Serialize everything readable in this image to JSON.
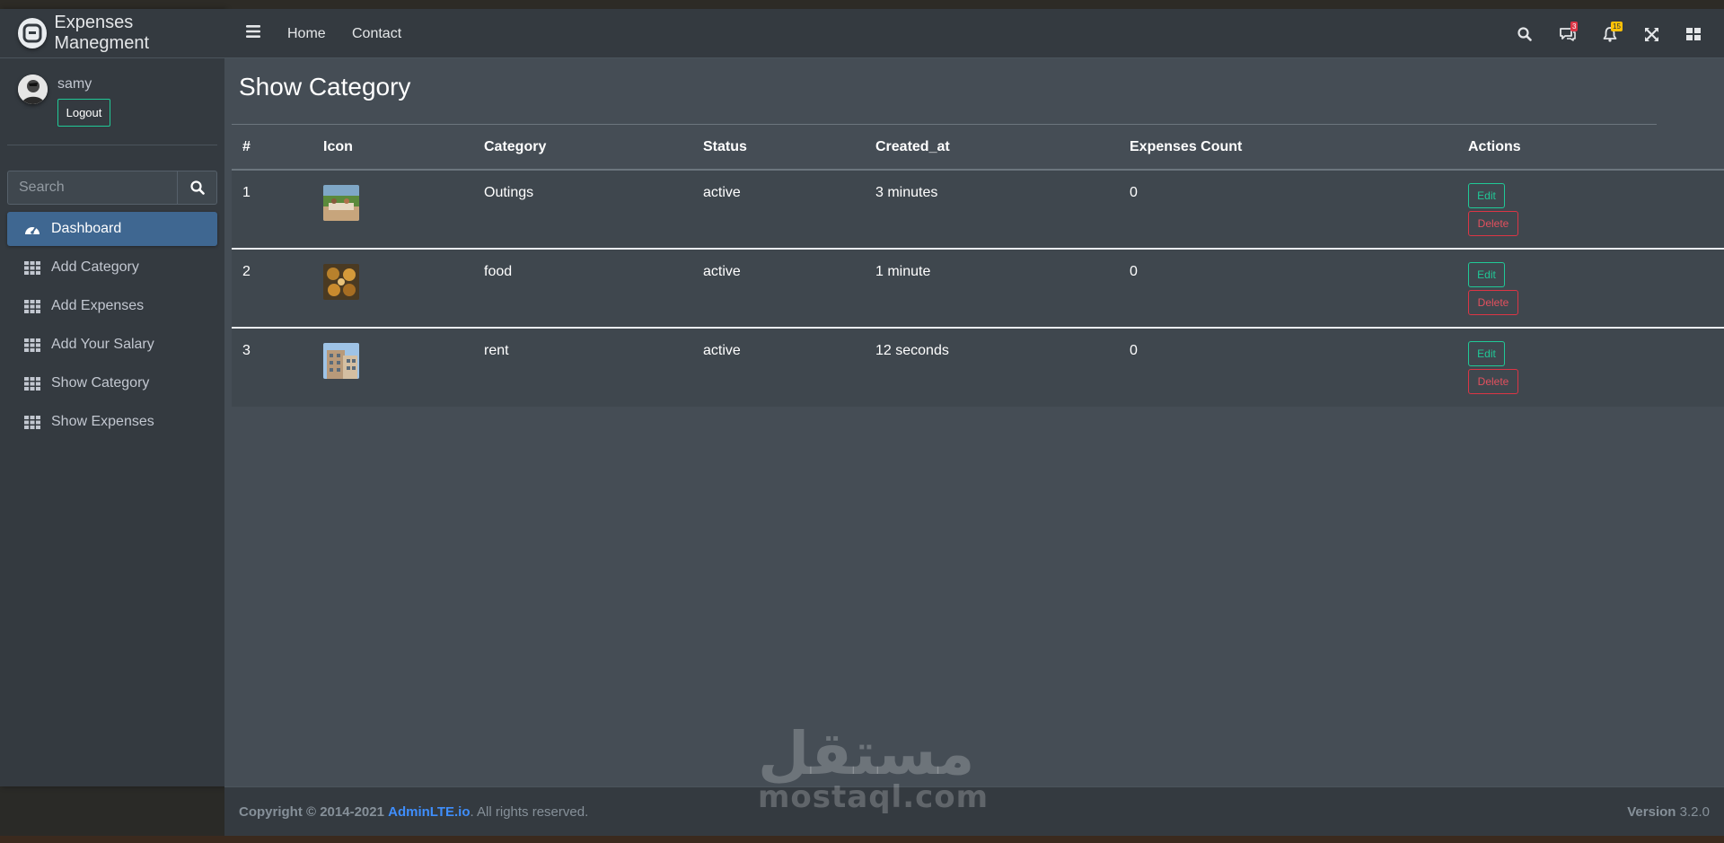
{
  "brand": {
    "title": "Expenses Manegment",
    "logo_icon": "adminlte-logo-icon"
  },
  "user": {
    "name": "samy",
    "logout_label": "Logout"
  },
  "sidebar_search": {
    "placeholder": "Search",
    "icon": "search-icon"
  },
  "sidebar": {
    "items": [
      {
        "label": "Dashboard",
        "icon": "tachometer-icon",
        "active": true
      },
      {
        "label": "Add Category",
        "icon": "table-icon",
        "active": false
      },
      {
        "label": "Add Expenses",
        "icon": "table-icon",
        "active": false
      },
      {
        "label": "Add Your Salary",
        "icon": "table-icon",
        "active": false
      },
      {
        "label": "Show Category",
        "icon": "table-icon",
        "active": false
      },
      {
        "label": "Show Expenses",
        "icon": "table-icon",
        "active": false
      }
    ]
  },
  "header": {
    "nav": [
      {
        "label": "Home"
      },
      {
        "label": "Contact"
      }
    ],
    "messages_badge": "3",
    "notifications_badge": "15"
  },
  "page": {
    "title": "Show Category"
  },
  "table": {
    "columns": [
      "#",
      "Icon",
      "Category",
      "Status",
      "Created_at",
      "Expenses Count",
      "Actions"
    ],
    "rows": [
      {
        "num": "1",
        "category": "Outings",
        "status": "active",
        "created_at": "3 minutes",
        "expenses_count": "0"
      },
      {
        "num": "2",
        "category": "food",
        "status": "active",
        "created_at": "1 minute",
        "expenses_count": "0"
      },
      {
        "num": "3",
        "category": "rent",
        "status": "active",
        "created_at": "12 seconds",
        "expenses_count": "0"
      }
    ],
    "edit_label": "Edit",
    "delete_label": "Delete"
  },
  "footer": {
    "copyright": "Copyright © 2014-2021",
    "link": "AdminLTE.io",
    "rights": ". All rights reserved.",
    "version_label": "Version",
    "version": "3.2.0"
  },
  "watermark": {
    "arabic": "مستقل",
    "latin": "mostaql.com"
  },
  "colors": {
    "sidebar_bg": "#343a40",
    "content_bg": "#454d55",
    "active_item": "#3f6791",
    "edit_accent": "#20c997",
    "delete_accent": "#dc3545",
    "link": "#3f8efc"
  }
}
